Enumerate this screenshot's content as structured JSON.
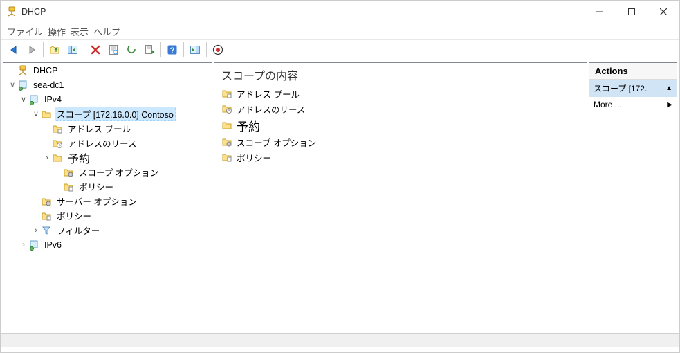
{
  "window": {
    "title": "DHCP"
  },
  "menu": {
    "file": "ファイル",
    "action": "操作",
    "view": "表示",
    "help": "ヘルプ"
  },
  "tree": {
    "root": "DHCP",
    "server": "sea-dc1",
    "ipv4": "IPv4",
    "scope": "スコープ [172.16.0.0] Contoso",
    "addresspool": "アドレス プール",
    "leases": "アドレスのリース",
    "reservations": "予約",
    "scopeoptions": "スコープ オプション",
    "policies": "ポリシー",
    "serveroptions": "サーバー オプション",
    "srvpolicies": "ポリシー",
    "filters": "フィルター",
    "ipv6": "IPv6"
  },
  "detail": {
    "header": "スコープの内容",
    "items": {
      "addresspool": "アドレス プール",
      "leases": "アドレスのリース",
      "reservations": "予約",
      "scopeoptions": "スコープ オプション",
      "policies": "ポリシー"
    }
  },
  "actions": {
    "header": "Actions",
    "scoperow": "スコープ [172.",
    "more": "More ..."
  }
}
